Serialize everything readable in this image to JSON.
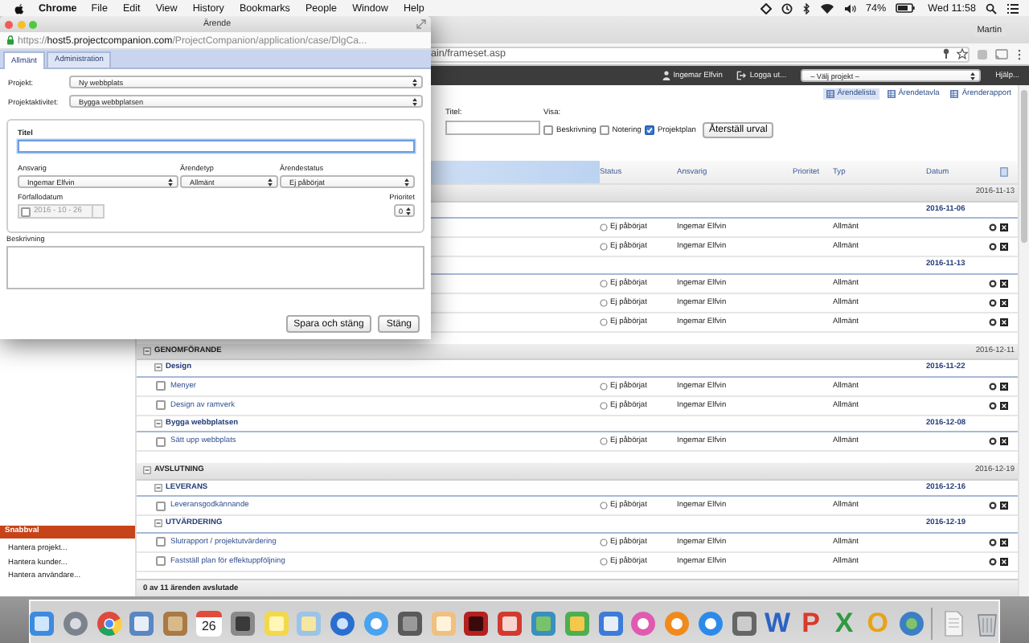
{
  "menu_bar": {
    "app": "Chrome",
    "items": [
      "File",
      "Edit",
      "View",
      "History",
      "Bookmarks",
      "People",
      "Window",
      "Help"
    ],
    "battery": "74%",
    "clock": "Wed 11:58"
  },
  "browser": {
    "profile": "Martin",
    "address": "ain/frameset.asp",
    "top_bar": {
      "user": "Ingemar Elfvin",
      "logout": "Logga ut...",
      "project_select": "– Välj projekt –",
      "help": "Hjälp..."
    },
    "views": [
      {
        "label": "Ärendelista",
        "selected": true
      },
      {
        "label": "Ärendetavla",
        "selected": false
      },
      {
        "label": "Ärenderapport",
        "selected": false
      }
    ],
    "filters": {
      "title_label": "Titel:",
      "show_label": "Visa:",
      "options": [
        {
          "label": "Beskrivning",
          "checked": false
        },
        {
          "label": "Notering",
          "checked": false
        },
        {
          "label": "Projektplan",
          "checked": true
        }
      ],
      "reset_button": "Återställ urval"
    },
    "table": {
      "columns": [
        "Status",
        "Ansvarig",
        "Prioritet",
        "Typ",
        "Datum"
      ],
      "rows": [
        {
          "kind": "group",
          "date": "2016-11-13"
        },
        {
          "kind": "subgroup",
          "date": "2016-11-06"
        },
        {
          "kind": "task",
          "status": "Ej påbörjat",
          "owner": "Ingemar Elfvin",
          "type": "Allmänt"
        },
        {
          "kind": "task",
          "status": "Ej påbörjat",
          "owner": "Ingemar Elfvin",
          "type": "Allmänt"
        },
        {
          "kind": "subgroup",
          "date": "2016-11-13"
        },
        {
          "kind": "task",
          "status": "Ej påbörjat",
          "owner": "Ingemar Elfvin",
          "type": "Allmänt"
        },
        {
          "kind": "task",
          "status": "Ej påbörjat",
          "owner": "Ingemar Elfvin",
          "type": "Allmänt"
        },
        {
          "kind": "task",
          "status": "Ej påbörjat",
          "owner": "Ingemar Elfvin",
          "type": "Allmänt"
        },
        {
          "kind": "group",
          "title": "GENOMFÖRANDE",
          "date": "2016-12-11"
        },
        {
          "kind": "subgroup",
          "title": "Design",
          "date": "2016-11-22"
        },
        {
          "kind": "task",
          "title": "Menyer",
          "checked": false,
          "status": "Ej påbörjat",
          "owner": "Ingemar Elfvin",
          "type": "Allmänt"
        },
        {
          "kind": "task",
          "title": "Design av ramverk",
          "checked": false,
          "status": "Ej påbörjat",
          "owner": "Ingemar Elfvin",
          "type": "Allmänt"
        },
        {
          "kind": "subgroup",
          "title": "Bygga webbplatsen",
          "date": "2016-12-08"
        },
        {
          "kind": "task",
          "title": "Sätt upp webbplats",
          "checked": false,
          "status": "Ej påbörjat",
          "owner": "Ingemar Elfvin",
          "type": "Allmänt"
        },
        {
          "kind": "group",
          "title": "AVSLUTNING",
          "date": "2016-12-19"
        },
        {
          "kind": "subgroup",
          "title": "LEVERANS",
          "date": "2016-12-16"
        },
        {
          "kind": "task",
          "title": "Leveransgodkännande",
          "checked": false,
          "status": "Ej påbörjat",
          "owner": "Ingemar Elfvin",
          "type": "Allmänt"
        },
        {
          "kind": "subgroup",
          "title": "UTVÄRDERING",
          "date": "2016-12-19"
        },
        {
          "kind": "task",
          "title": "Slutrapport / projektutvärdering",
          "checked": false,
          "status": "Ej påbörjat",
          "owner": "Ingemar Elfvin",
          "type": "Allmänt"
        },
        {
          "kind": "task",
          "title": "Fastställ plan för effektuppföljning",
          "checked": false,
          "status": "Ej påbörjat",
          "owner": "Ingemar Elfvin",
          "type": "Allmänt"
        }
      ],
      "footer": "0 av 11 ärenden avslutade"
    },
    "sidebar": {
      "heading": "Snabbval",
      "links": [
        "Hantera projekt...",
        "Hantera kunder...",
        "Hantera användare..."
      ]
    }
  },
  "dialog": {
    "title": "Ärende",
    "url_scheme": "https://",
    "url_host": "host5.projectcompanion.com",
    "url_path": "/ProjectCompanion/application/case/DlgCa...",
    "tabs": [
      {
        "label": "Allmänt",
        "selected": true
      },
      {
        "label": "Administration",
        "selected": false
      }
    ],
    "project": {
      "label": "Projekt:",
      "value": "Ny webbplats"
    },
    "activity": {
      "label": "Projektaktivitet:",
      "value": "Bygga webbplatsen"
    },
    "title_field": {
      "label": "Titel",
      "focused": true
    },
    "owner": {
      "label": "Ansvarig",
      "value": "Ingemar Elfvin"
    },
    "case_type": {
      "label": "Ärendetyp",
      "value": "Allmänt"
    },
    "case_status": {
      "label": "Ärendestatus",
      "value": "Ej påbörjat"
    },
    "due_date": {
      "label": "Förfallodatum",
      "value": "2016 - 10 - 26",
      "checked": false,
      "disabled": true
    },
    "priority": {
      "label": "Prioritet",
      "value": "0"
    },
    "description": {
      "label": "Beskrivning"
    },
    "buttons": [
      "Spara och stäng",
      "Stäng"
    ]
  },
  "dock": {
    "calendar_day": "26",
    "letter_icons": [
      {
        "letter": "W",
        "color": "#2b63c4"
      },
      {
        "letter": "P",
        "color": "#d83b2b"
      },
      {
        "letter": "X",
        "color": "#2e9a3e"
      },
      {
        "letter": "O",
        "color": "#e8a317"
      }
    ]
  }
}
